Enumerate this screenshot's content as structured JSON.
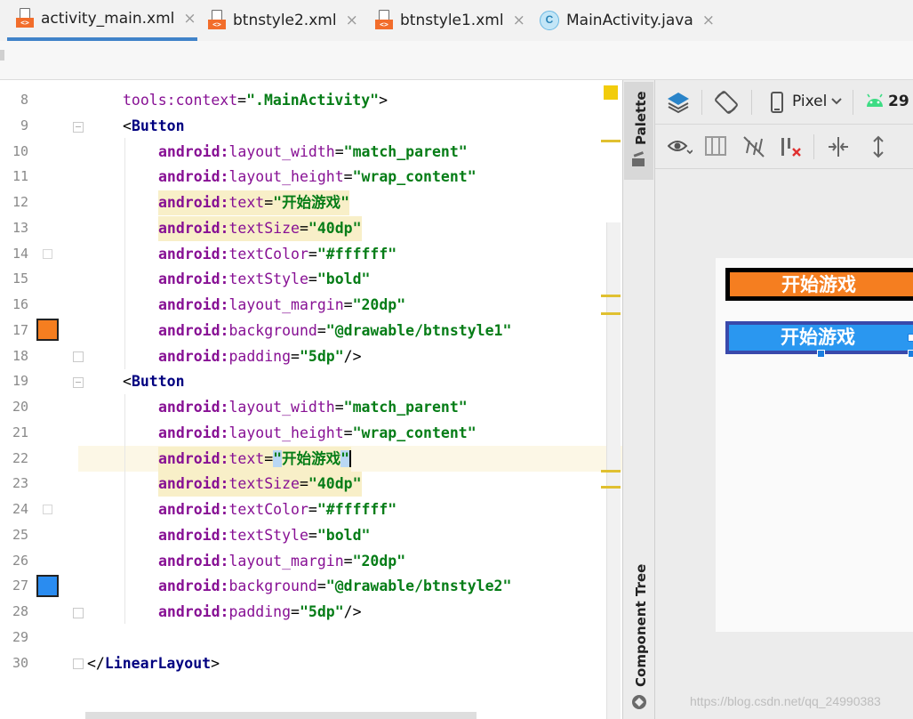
{
  "tabs": [
    {
      "label": "activity_main.xml",
      "icon": "xml-file-icon",
      "active": true
    },
    {
      "label": "btnstyle2.xml",
      "icon": "xml-file-icon",
      "active": false
    },
    {
      "label": "btnstyle1.xml",
      "icon": "xml-file-icon",
      "active": false
    },
    {
      "label": "MainActivity.java",
      "icon": "java-class-icon",
      "active": false
    }
  ],
  "tab_close_glyph": "×",
  "xml_badge": "<>",
  "class_badge": "C",
  "editor": {
    "line_numbers": [
      "8",
      "9",
      "10",
      "11",
      "12",
      "13",
      "14",
      "15",
      "16",
      "17",
      "18",
      "19",
      "20",
      "21",
      "22",
      "23",
      "24",
      "25",
      "26",
      "27",
      "28",
      "29",
      "30"
    ],
    "lines": {
      "l8": {
        "attr": "tools:context",
        "eq": "=",
        "val": "\".MainActivity\"",
        "close": ">"
      },
      "l9": {
        "open": "<",
        "tag": "Button"
      },
      "l10": {
        "ns": "android:",
        "attr": "layout_width",
        "eq": "=",
        "val": "\"match_parent\""
      },
      "l11": {
        "ns": "android:",
        "attr": "layout_height",
        "eq": "=",
        "val": "\"wrap_content\""
      },
      "l12": {
        "ns": "android:",
        "attr": "text",
        "eq": "=",
        "val": "\"开始游戏\""
      },
      "l13": {
        "ns": "android:",
        "attr": "textSize",
        "eq": "=",
        "val": "\"40dp\""
      },
      "l14": {
        "ns": "android:",
        "attr": "textColor",
        "eq": "=",
        "val": "\"#ffffff\""
      },
      "l15": {
        "ns": "android:",
        "attr": "textStyle",
        "eq": "=",
        "val": "\"bold\""
      },
      "l16": {
        "ns": "android:",
        "attr": "layout_margin",
        "eq": "=",
        "val": "\"20dp\""
      },
      "l17": {
        "ns": "android:",
        "attr": "background",
        "eq": "=",
        "val": "\"@drawable/btnstyle1\""
      },
      "l18": {
        "ns": "android:",
        "attr": "padding",
        "eq": "=",
        "val": "\"5dp\"",
        "close": "/>"
      },
      "l19": {
        "open": "<",
        "tag": "Button"
      },
      "l20": {
        "ns": "android:",
        "attr": "layout_width",
        "eq": "=",
        "val": "\"match_parent\""
      },
      "l21": {
        "ns": "android:",
        "attr": "layout_height",
        "eq": "=",
        "val": "\"wrap_content\""
      },
      "l22": {
        "ns": "android:",
        "attr": "text",
        "eq": "=",
        "q1": "\"",
        "valtext": "开始游戏",
        "q2": "\""
      },
      "l23": {
        "ns": "android:",
        "attr": "textSize",
        "eq": "=",
        "val": "\"40dp\""
      },
      "l24": {
        "ns": "android:",
        "attr": "textColor",
        "eq": "=",
        "val": "\"#ffffff\""
      },
      "l25": {
        "ns": "android:",
        "attr": "textStyle",
        "eq": "=",
        "val": "\"bold\""
      },
      "l26": {
        "ns": "android:",
        "attr": "layout_margin",
        "eq": "=",
        "val": "\"20dp\""
      },
      "l27": {
        "ns": "android:",
        "attr": "background",
        "eq": "=",
        "val": "\"@drawable/btnstyle2\""
      },
      "l28": {
        "ns": "android:",
        "attr": "padding",
        "eq": "=",
        "val": "\"5dp\"",
        "close": "/>"
      },
      "l30": {
        "open": "</",
        "tag": "LinearLayout",
        "close": ">"
      }
    },
    "gutter_swatches": {
      "line14": "#ffffff",
      "line17": "#f57e20",
      "line24": "#ffffff",
      "line27": "#2a8cf0"
    }
  },
  "side_panel": {
    "palette_label": "Palette",
    "component_tree_label": "Component Tree"
  },
  "design_toolbar": {
    "device_label": "Pixel",
    "api_level": "29"
  },
  "preview": {
    "button1": {
      "text": "开始游戏",
      "background": "#f57e20",
      "border": "#000000"
    },
    "button2": {
      "text": "开始游戏",
      "background": "#2a97f0",
      "border": "#3949ab"
    }
  },
  "watermark": "https://blog.csdn.net/qq_24990383",
  "colors": {
    "accent": "#4083c9",
    "xml_tag": "#000080",
    "xml_attr": "#871094",
    "xml_value": "#067d17"
  }
}
